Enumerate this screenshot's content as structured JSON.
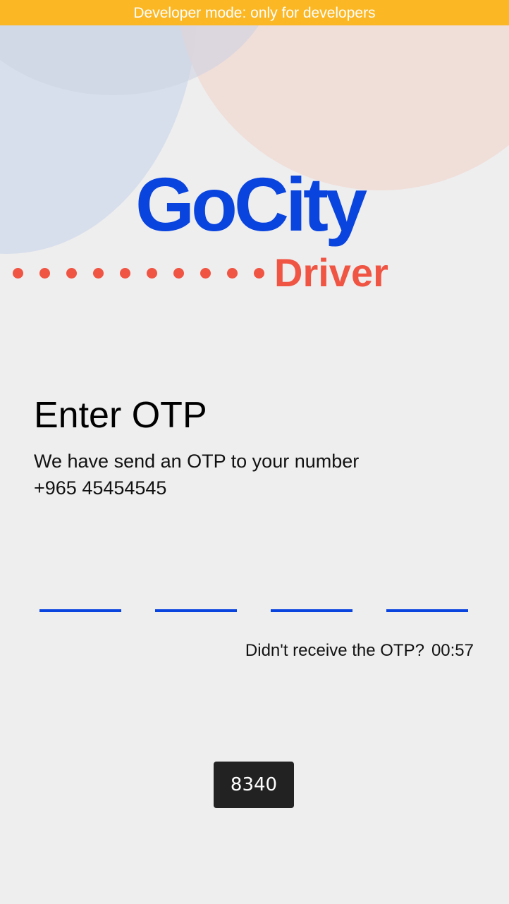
{
  "banner": {
    "text": "Developer mode: only for developers"
  },
  "logo": {
    "brand": "GoCity",
    "subtitle": "Driver"
  },
  "otp": {
    "title": "Enter OTP",
    "subtitle_line1": "We have send an OTP to your number",
    "phone": "+965 45454545",
    "fields": [
      "",
      "",
      "",
      ""
    ],
    "resend_prompt": "Didn't receive the OTP?",
    "timer": "00:57"
  },
  "toast": {
    "text": "8340"
  },
  "colors": {
    "banner": "#fbb724",
    "brand_blue": "#0a44df",
    "brand_red": "#f05443",
    "background": "#eeeeee"
  }
}
